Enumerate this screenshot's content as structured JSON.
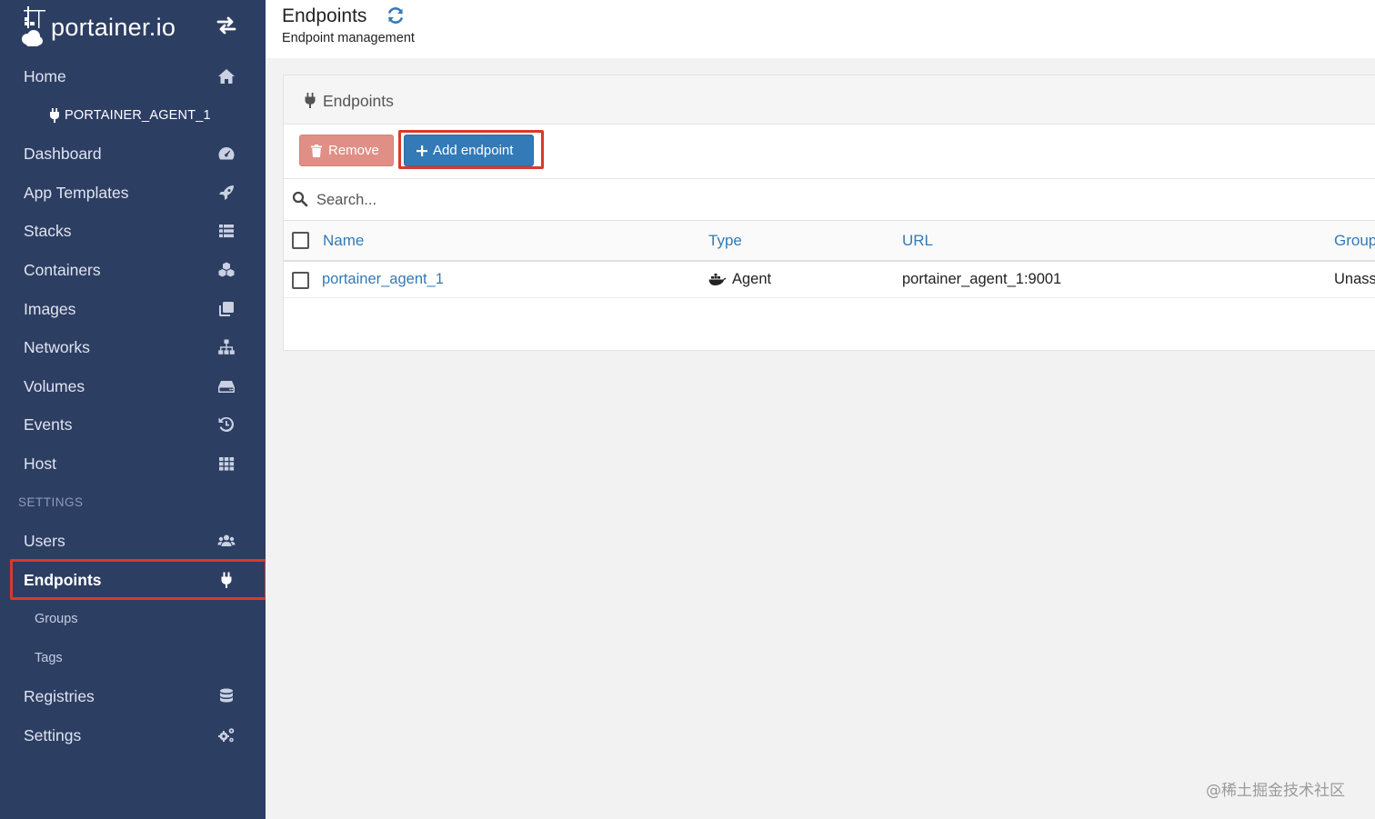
{
  "sidebar": {
    "brand": "portainer.io",
    "items": [
      {
        "label": "Home",
        "icon": "home-icon"
      },
      {
        "label": "Dashboard",
        "icon": "tachometer-icon"
      },
      {
        "label": "App Templates",
        "icon": "rocket-icon"
      },
      {
        "label": "Stacks",
        "icon": "list-icon"
      },
      {
        "label": "Containers",
        "icon": "cubes-icon"
      },
      {
        "label": "Images",
        "icon": "clone-icon"
      },
      {
        "label": "Networks",
        "icon": "sitemap-icon"
      },
      {
        "label": "Volumes",
        "icon": "hdd-icon"
      },
      {
        "label": "Events",
        "icon": "history-icon"
      },
      {
        "label": "Host",
        "icon": "th-icon"
      }
    ],
    "endpoint_name": "PORTAINER_AGENT_1",
    "settings_heading": "SETTINGS",
    "settings_items": [
      {
        "label": "Users",
        "icon": "users-icon"
      },
      {
        "label": "Endpoints",
        "icon": "plug-icon",
        "active": true
      },
      {
        "label": "Groups"
      },
      {
        "label": "Tags"
      },
      {
        "label": "Registries",
        "icon": "database-icon"
      },
      {
        "label": "Settings",
        "icon": "cogs-icon"
      }
    ]
  },
  "header": {
    "title": "Endpoints",
    "subtitle": "Endpoint management"
  },
  "panel": {
    "title": "Endpoints",
    "remove_label": "Remove",
    "add_label": "Add endpoint",
    "search_placeholder": "Search...",
    "columns": [
      "Name",
      "Type",
      "URL",
      "Group"
    ],
    "rows": [
      {
        "name": "portainer_agent_1",
        "type": "Agent",
        "url": "portainer_agent_1:9001",
        "group": "Unass"
      }
    ]
  },
  "watermark": "@稀土掘金技术社区",
  "colors": {
    "sidebar_bg": "#2d3e63",
    "primary": "#337ab7",
    "danger": "#e08f86",
    "highlight": "#d9392b"
  }
}
